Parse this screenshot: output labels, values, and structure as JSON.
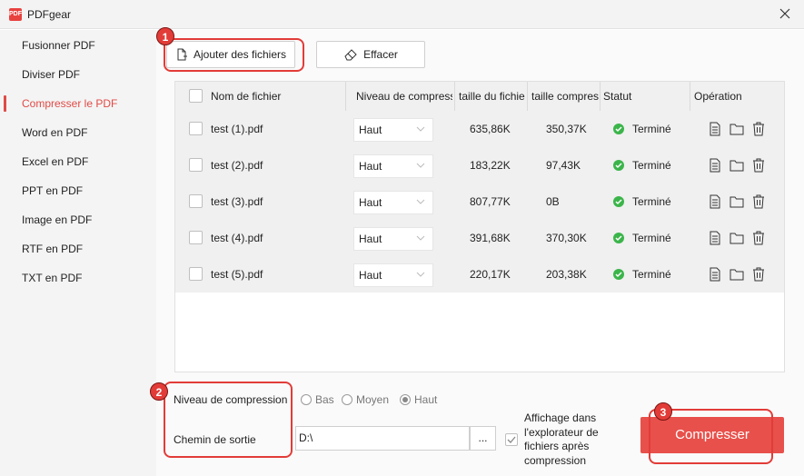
{
  "window": {
    "title": "PDFgear",
    "logo_text": "PDF"
  },
  "sidebar": {
    "items": [
      {
        "label": "Fusionner PDF",
        "active": false
      },
      {
        "label": "Diviser PDF",
        "active": false
      },
      {
        "label": "Compresser le PDF",
        "active": true
      },
      {
        "label": "Word en PDF",
        "active": false
      },
      {
        "label": "Excel en PDF",
        "active": false
      },
      {
        "label": "PPT en PDF",
        "active": false
      },
      {
        "label": "Image en PDF",
        "active": false
      },
      {
        "label": "RTF en PDF",
        "active": false
      },
      {
        "label": "TXT en PDF",
        "active": false
      }
    ]
  },
  "toolbar": {
    "add_label": "Ajouter des fichiers",
    "clear_label": "Effacer"
  },
  "table": {
    "headers": [
      "Nom de fichier",
      "Niveau de compression",
      "taille du fichier",
      "taille compressée",
      "Statut",
      "Opération"
    ],
    "rows": [
      {
        "name": "test (1).pdf",
        "level": "Haut",
        "size": "635,86K",
        "compressed": "350,37K",
        "status": "Terminé"
      },
      {
        "name": "test (2).pdf",
        "level": "Haut",
        "size": "183,22K",
        "compressed": "97,43K",
        "status": "Terminé"
      },
      {
        "name": "test (3).pdf",
        "level": "Haut",
        "size": "807,77K",
        "compressed": "0B",
        "status": "Terminé"
      },
      {
        "name": "test (4).pdf",
        "level": "Haut",
        "size": "391,68K",
        "compressed": "370,30K",
        "status": "Terminé"
      },
      {
        "name": "test (5).pdf",
        "level": "Haut",
        "size": "220,17K",
        "compressed": "203,38K",
        "status": "Terminé"
      }
    ]
  },
  "options": {
    "compression_label": "Niveau de compression",
    "levels": [
      "Bas",
      "Moyen",
      "Haut"
    ],
    "selected_level": "Haut",
    "output_label": "Chemin de sortie",
    "output_path": "D:\\",
    "browse_label": "...",
    "explorer_label": "Affichage dans l'explorateur de fichiers après compression",
    "explorer_checked": true
  },
  "compress_label": "Compresser",
  "annotations": [
    "1",
    "2",
    "3"
  ],
  "colors": {
    "accent": "#e8504b",
    "status_ok": "#3bb54a",
    "highlight": "#e23c38"
  }
}
